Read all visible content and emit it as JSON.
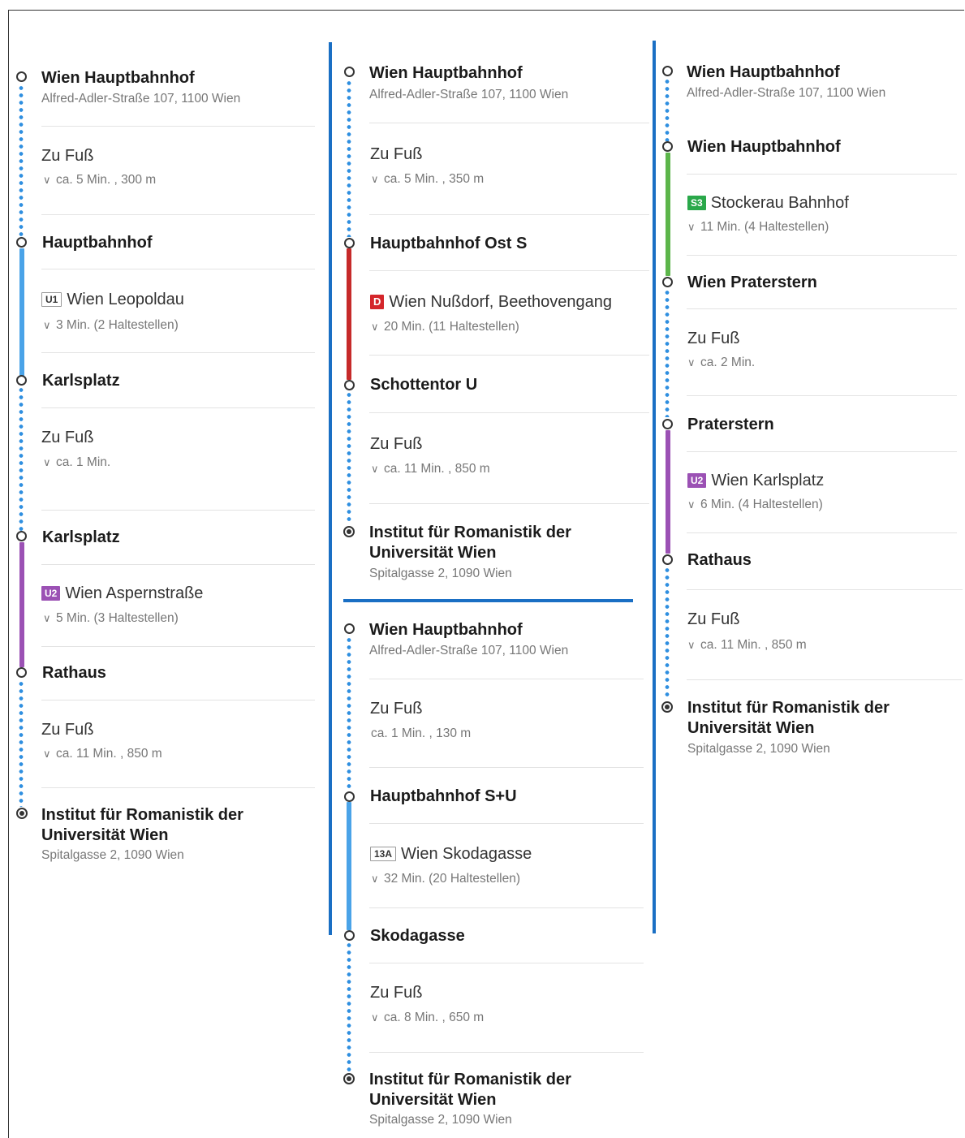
{
  "routes": {
    "r1": {
      "start": {
        "name": "Wien Hauptbahnhof",
        "address": "Alfred-Adler-Straße 107, 1100 Wien"
      },
      "walk1": {
        "label": "Zu Fuß",
        "detail": "ca. 5 Min. , 300 m"
      },
      "stop1": "Hauptbahnhof",
      "ride1": {
        "line": "U1",
        "direction": "Wien Leopoldau",
        "detail": "3 Min. (2 Haltestellen)"
      },
      "stop2": "Karlsplatz",
      "walk2": {
        "label": "Zu Fuß",
        "detail": "ca. 1 Min."
      },
      "stop3": "Karlsplatz",
      "ride2": {
        "line": "U2",
        "direction": "Wien Aspernstraße",
        "detail": "5 Min. (3 Haltestellen)"
      },
      "stop4": "Rathaus",
      "walk3": {
        "label": "Zu Fuß",
        "detail": "ca. 11 Min. , 850 m"
      },
      "dest": {
        "name": "Institut für Romanistik der Universität Wien",
        "address": "Spitalgasse 2, 1090 Wien"
      }
    },
    "r2": {
      "start": {
        "name": "Wien Hauptbahnhof",
        "address": "Alfred-Adler-Straße 107, 1100 Wien"
      },
      "walk1": {
        "label": "Zu Fuß",
        "detail": "ca. 5 Min. , 350 m"
      },
      "stop1": "Hauptbahnhof Ost S",
      "ride1": {
        "line": "D",
        "direction": "Wien Nußdorf, Beethovengang",
        "detail": "20 Min. (11 Haltestellen)"
      },
      "stop2": "Schottentor U",
      "walk2": {
        "label": "Zu Fuß",
        "detail": "ca. 11 Min. , 850 m"
      },
      "dest": {
        "name": "Institut für Romanistik der Universität Wien",
        "address": "Spitalgasse 2, 1090 Wien"
      }
    },
    "r3": {
      "start": {
        "name": "Wien Hauptbahnhof",
        "address": "Alfred-Adler-Straße 107, 1100 Wien"
      },
      "walk1": {
        "label": "Zu Fuß",
        "detail": "ca. 1 Min. , 130 m"
      },
      "stop1": "Hauptbahnhof S+U",
      "ride1": {
        "line": "13A",
        "direction": "Wien Skodagasse",
        "detail": "32 Min. (20 Haltestellen)"
      },
      "stop2": "Skodagasse",
      "walk2": {
        "label": "Zu Fuß",
        "detail": "ca. 8 Min. , 650 m"
      },
      "dest": {
        "name": "Institut für Romanistik der Universität Wien",
        "address": "Spitalgasse 2, 1090 Wien"
      }
    },
    "r4": {
      "start": {
        "name": "Wien Hauptbahnhof",
        "address": "Alfred-Adler-Straße 107, 1100 Wien"
      },
      "stop1": "Wien Hauptbahnhof",
      "ride1": {
        "line": "S3",
        "direction": "Stockerau Bahnhof",
        "detail": "11 Min. (4 Haltestellen)"
      },
      "stop2": "Wien Praterstern",
      "walk1": {
        "label": "Zu Fuß",
        "detail": "ca. 2 Min."
      },
      "stop3": "Praterstern",
      "ride2": {
        "line": "U2",
        "direction": "Wien Karlsplatz",
        "detail": "6 Min. (4 Haltestellen)"
      },
      "stop4": "Rathaus",
      "walk2": {
        "label": "Zu Fuß",
        "detail": "ca. 11 Min. , 850 m"
      },
      "dest": {
        "name": "Institut für Romanistik der Universität Wien",
        "address": "Spitalgasse 2, 1090 Wien"
      }
    }
  },
  "colors": {
    "walk_dots": "#2f8fe0",
    "u1_line": "#4aa3e8",
    "u2_line": "#9b51b4",
    "d_line": "#c62a2a",
    "s3_line": "#5cb54a",
    "bus_line": "#4aa3e8",
    "separator": "#1a6fc4"
  },
  "icons": {
    "chevron": "chevron-down-icon",
    "stop": "stop-circle-icon",
    "destination": "destination-icon"
  }
}
